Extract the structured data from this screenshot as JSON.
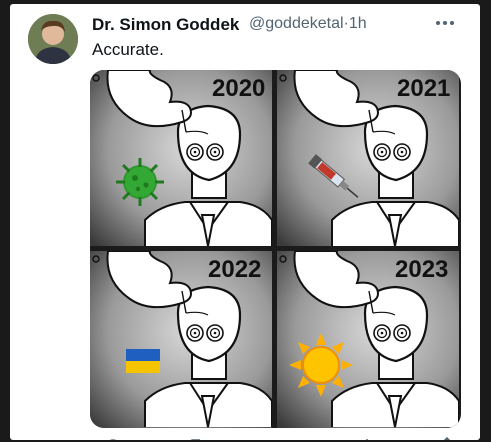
{
  "tweet": {
    "author_name": "Dr. Simon Goddek",
    "handle": "@goddeketal",
    "separator": "·",
    "time": "1h",
    "text": "Accurate."
  },
  "media": {
    "panels": [
      {
        "year": "2020",
        "item": "virus-icon"
      },
      {
        "year": "2021",
        "item": "syringe-icon"
      },
      {
        "year": "2022",
        "item": "ukraine-flag-icon"
      },
      {
        "year": "2023",
        "item": "sun-icon"
      }
    ]
  },
  "colors": {
    "accent": "#1d9bf0",
    "text_primary": "#0f1419",
    "text_secondary": "#536471",
    "virus_green": "#2e9a2e",
    "flag_blue": "#1f5fbf",
    "flag_yellow": "#f5c400",
    "sun_yellow": "#ffc400"
  }
}
